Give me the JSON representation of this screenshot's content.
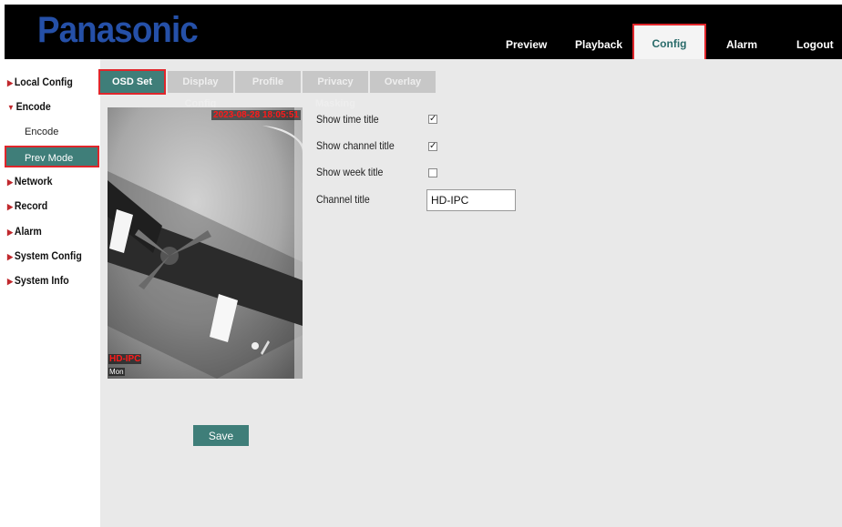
{
  "header": {
    "logo": "Panasonic",
    "nav": [
      {
        "label": "Preview"
      },
      {
        "label": "Playback"
      },
      {
        "label": "Config"
      },
      {
        "label": "Alarm"
      },
      {
        "label": "Logout"
      }
    ],
    "active_nav": "Config"
  },
  "sidebar": {
    "items": [
      {
        "label": "Local Config",
        "arrow": "▶"
      },
      {
        "label": "Encode",
        "arrow": "▼"
      },
      {
        "label": "Network",
        "arrow": "▶"
      },
      {
        "label": "Record",
        "arrow": "▶"
      },
      {
        "label": "Alarm",
        "arrow": "▶"
      },
      {
        "label": "System Config",
        "arrow": "▶"
      },
      {
        "label": "System Info",
        "arrow": "▶"
      }
    ],
    "encode_sub": [
      {
        "label": "Encode"
      },
      {
        "label": "Prev Mode"
      }
    ]
  },
  "tabs": [
    {
      "label": "OSD Set"
    },
    {
      "label": "Display Config"
    },
    {
      "label": "Profile"
    },
    {
      "label": "Privacy Masking"
    },
    {
      "label": "Overlay"
    }
  ],
  "preview": {
    "osd_time": "2023-08-28 18:05:51",
    "osd_channel": "HD-IPC",
    "osd_week": "Mon"
  },
  "form": {
    "show_time_title": {
      "label": "Show time title",
      "checked": "✓"
    },
    "show_channel_title": {
      "label": "Show channel title",
      "checked": "✓"
    },
    "show_week_title": {
      "label": "Show week title",
      "checked": ""
    },
    "channel_title": {
      "label": "Channel title",
      "value": "HD-IPC"
    }
  },
  "buttons": {
    "save": "Save"
  },
  "colors": {
    "topbar": "#000000",
    "logo": "#2550a8",
    "accent": "#3f7e79",
    "highlight_border": "#e0262b",
    "content_bg": "#e9e9e9",
    "tab_inactive": "#c7c7c7"
  }
}
